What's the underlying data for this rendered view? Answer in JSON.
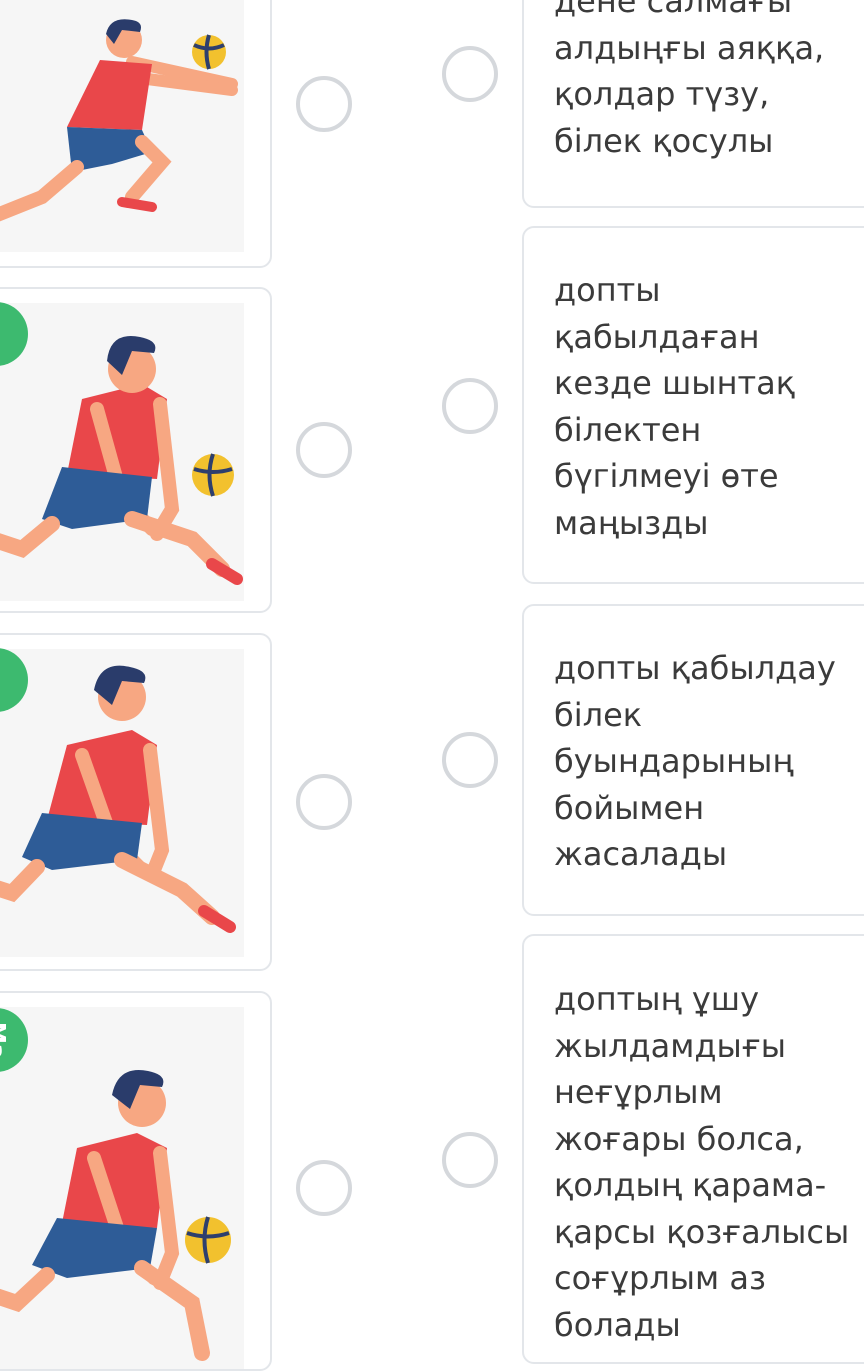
{
  "images": [
    {
      "badge": "",
      "alt_icon": "volleyball-player-icon"
    },
    {
      "badge": "",
      "alt_icon": "volleyball-player-icon"
    },
    {
      "badge": "",
      "alt_icon": "volleyball-player-icon"
    },
    {
      "badge": "Ma",
      "alt_icon": "volleyball-player-icon"
    }
  ],
  "answers": [
    {
      "text": "дене салмағы\nалдыңғы аяққа,\nқолдар түзу,\nбілек қосулы"
    },
    {
      "text": "допты\nқабылдаған\nкезде шынтақ\nбілектен\nбүгілмеуі өте\nмаңызды"
    },
    {
      "text": "допты қабылдау\nбілек\nбуындарының\nбойымен\nжасалады"
    },
    {
      "text": "доптың ұшу\nжылдамдығы\nнеғұрлым\nжоғары болса,\nқолдың қарама-\nқарсы қозғалысы\nсоғұрлым аз\nболады"
    }
  ],
  "colors": {
    "badge": "#3dba6f",
    "shirt": "#e9474a",
    "shorts": "#2e5c97",
    "skin": "#f7a782",
    "hair": "#2a3c6b",
    "ball_yellow": "#f2c12e"
  }
}
